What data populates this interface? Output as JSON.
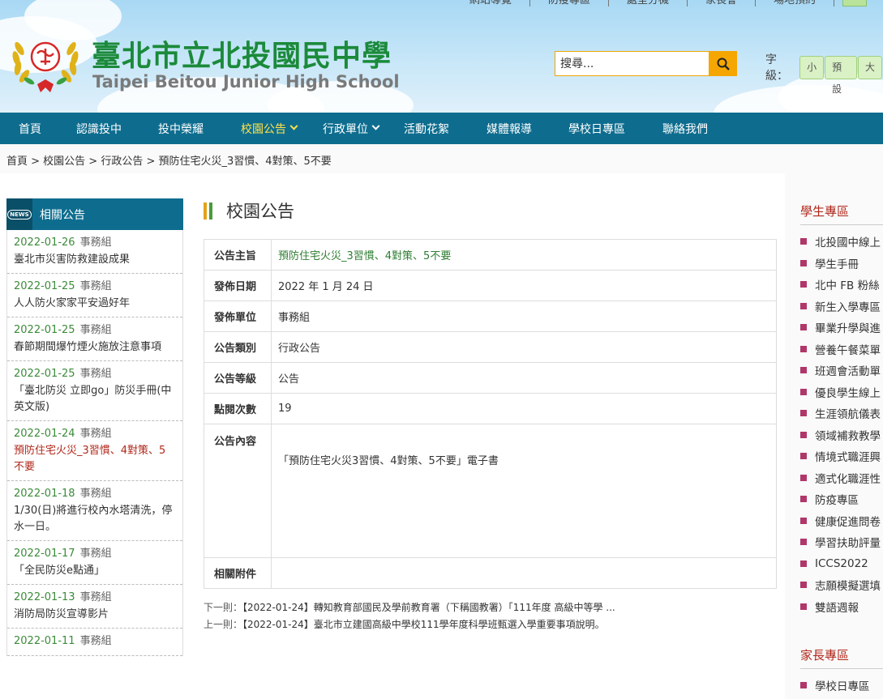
{
  "topnav": {
    "items": [
      "網站導覽",
      "防疫專區",
      "處室分機",
      "家長會",
      "場地預約"
    ]
  },
  "school": {
    "name_zh": "臺北市立北投國民中學",
    "name_en": "Taipei Beitou Junior High School"
  },
  "search": {
    "placeholder": "搜尋..."
  },
  "fontsize": {
    "label": "字級：",
    "small": "小",
    "default": "預設",
    "large": "大"
  },
  "mainnav": {
    "items": [
      {
        "label": "首頁"
      },
      {
        "label": "認識投中"
      },
      {
        "label": "投中榮耀"
      },
      {
        "label": "校園公告"
      },
      {
        "label": "行政單位"
      },
      {
        "label": "活動花絮"
      },
      {
        "label": "媒體報導"
      },
      {
        "label": "學校日專區"
      },
      {
        "label": "聯絡我們"
      }
    ]
  },
  "breadcrumb": "首頁 > 校園公告 > 行政公告 > 預防住宅火災_3習慣、4對策、5不要",
  "left_sidebar": {
    "badge": "NEWS",
    "title": "相關公告",
    "items": [
      {
        "date": "2022-01-26",
        "unit": "事務組",
        "title": "臺北市災害防救建設成果"
      },
      {
        "date": "2022-01-25",
        "unit": "事務組",
        "title": "人人防火家家平安過好年"
      },
      {
        "date": "2022-01-25",
        "unit": "事務組",
        "title": "春節期間爆竹煙火施放注意事項"
      },
      {
        "date": "2022-01-25",
        "unit": "事務組",
        "title": "「臺北防災 立即go」防災手冊(中英文版)"
      },
      {
        "date": "2022-01-24",
        "unit": "事務組",
        "title": "預防住宅火災_3習慣、4對策、5不要"
      },
      {
        "date": "2022-01-18",
        "unit": "事務組",
        "title": "1/30(日)將進行校內水塔清洗，停水一日。"
      },
      {
        "date": "2022-01-17",
        "unit": "事務組",
        "title": "「全民防災e點通」"
      },
      {
        "date": "2022-01-13",
        "unit": "事務組",
        "title": "消防局防災宣導影片"
      },
      {
        "date": "2022-01-11",
        "unit": "事務組",
        "title": ""
      }
    ]
  },
  "panel": {
    "title": "校園公告",
    "bar_colors": [
      "#e4a21a",
      "#4a9a3a"
    ],
    "rows": {
      "subject_label": "公告主旨",
      "subject": "預防住宅火災_3習慣、4對策、5不要",
      "date_label": "發佈日期",
      "date": "2022 年 1 月 24 日",
      "unit_label": "發佈單位",
      "unit": "事務組",
      "category_label": "公告類別",
      "category": "行政公告",
      "level_label": "公告等級",
      "level": "公告",
      "views_label": "點閱次數",
      "views": "19",
      "content_label": "公告內容",
      "content": "「預防住宅火災3習慣、4對策、5不要」電子書",
      "attach_label": "相關附件",
      "attach": ""
    },
    "next_label": "下一則：",
    "next": "【2022-01-24】轉知教育部國民及學前教育署（下稱國教署）「111年度 高級中等學 ...",
    "prev_label": "上一則：",
    "prev": "【2022-01-24】臺北市立建國高級中學校111學年度科學班甄選入學重要事項說明。"
  },
  "right_sidebar": {
    "student_title": "學生專區",
    "student_items": [
      "北投國中線上",
      "學生手冊",
      "北中 FB 粉絲",
      "新生入學專區",
      "畢業升學與進",
      "營養午餐菜單",
      "班週會活動單",
      "優良學生線上",
      "生涯領航儀表",
      "領域補救教學",
      "情境式職涯興",
      "適式化職涯性",
      "防疫專區",
      "健康促進問卷",
      "學習扶助評量",
      "ICCS2022",
      "志願模擬選填",
      "雙語週報"
    ],
    "parent_title": "家長專區",
    "parent_items": [
      "學校日專區"
    ]
  },
  "colors": {
    "nav_bg": "#0e6d8f",
    "nav_active": "#ffe24a",
    "brand_green": "#1b8a3a",
    "accent_red": "#b0281c",
    "search_btn": "#f5a600"
  }
}
